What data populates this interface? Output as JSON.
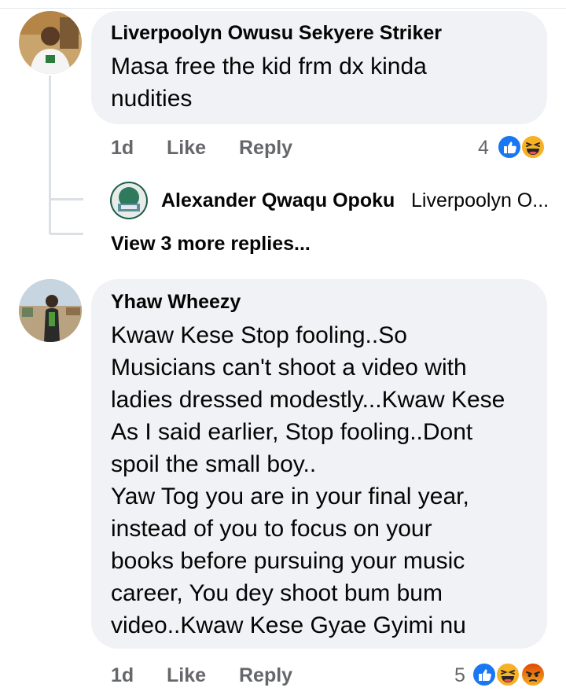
{
  "comments": [
    {
      "author": "Liverpoolyn Owusu Sekyere Striker",
      "text": "Masa free the kid frm dx kinda\nnudities",
      "time": "1d",
      "like_label": "Like",
      "reply_label": "Reply",
      "reaction_count": "4",
      "reactions": [
        "like-icon",
        "haha-icon"
      ]
    },
    {
      "author": "Yhaw Wheezy",
      "text": "Kwaw Kese Stop fooling..So\nMusicians can't shoot a video with\nladies dressed modestly...Kwaw Kese\nAs I said earlier, Stop fooling..Dont\nspoil the small boy..\nYaw Tog you are in your final year,\ninstead of you to focus on your\nbooks before pursuing your music\ncareer, You dey shoot bum bum\nvideo..Kwaw Kese Gyae Gyimi nu",
      "time": "1d",
      "like_label": "Like",
      "reply_label": "Reply",
      "reaction_count": "5",
      "reactions": [
        "like-icon",
        "haha-icon",
        "angry-icon"
      ]
    }
  ],
  "reply_preview": {
    "author": "Alexander Qwaqu Opoku",
    "preview": "Liverpoolyn O..."
  },
  "view_more": "View 3 more replies...",
  "colors": {
    "bubble": "#f0f2f5",
    "meta": "#65676b",
    "like_blue": "#1877f2",
    "haha_yellow": "#f7b125",
    "angry_orange": "#e9710f"
  }
}
